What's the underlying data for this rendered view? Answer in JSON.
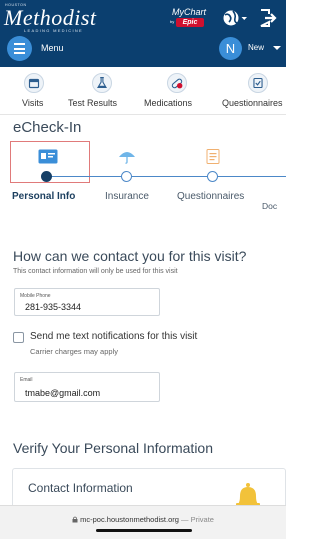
{
  "header": {
    "logo_top": "HOUSTON",
    "logo": "Methodist",
    "logo_tagline": "LEADING MEDICINE",
    "mychart": "MyChart",
    "mychart_by": "by",
    "epic": "Epic",
    "menu_label": "Menu",
    "avatar_initial": "N",
    "new_label": "New"
  },
  "nav_tabs": [
    {
      "label": "Visits",
      "icon": "calendar-icon"
    },
    {
      "label": "Test Results",
      "icon": "flask-icon"
    },
    {
      "label": "Medications",
      "icon": "pill-icon"
    },
    {
      "label": "Questionnaires",
      "icon": "checklist-icon"
    }
  ],
  "page_title": "eCheck-In",
  "steps": [
    {
      "label": "Personal Info",
      "active": true,
      "icon": "id-card-icon"
    },
    {
      "label": "Insurance",
      "active": false,
      "icon": "umbrella-icon"
    },
    {
      "label": "Questionnaires",
      "active": false,
      "icon": "clipboard-icon"
    },
    {
      "label": "Doc",
      "active": false,
      "icon": ""
    }
  ],
  "contact": {
    "heading": "How can we contact you for this visit?",
    "note": "This contact information will only be used for this visit",
    "phone_label": "Mobile Phone",
    "phone_value": "281-935-3344",
    "sms_label": "Send me text notifications for this visit",
    "sms_sub": "Carrier charges may apply",
    "email_label": "Email",
    "email_value": "tmabe@gmail.com"
  },
  "verify": {
    "heading": "Verify Your Personal Information",
    "card_title": "Contact Information"
  },
  "browser": {
    "url": "mc-poc.houstonmethodist.org",
    "private_label": "— Private"
  },
  "colors": {
    "header_bg": "#0b3f6f",
    "accent": "#3a8ed8",
    "step_active": "#163f66",
    "highlight_border": "#e07a7a"
  }
}
